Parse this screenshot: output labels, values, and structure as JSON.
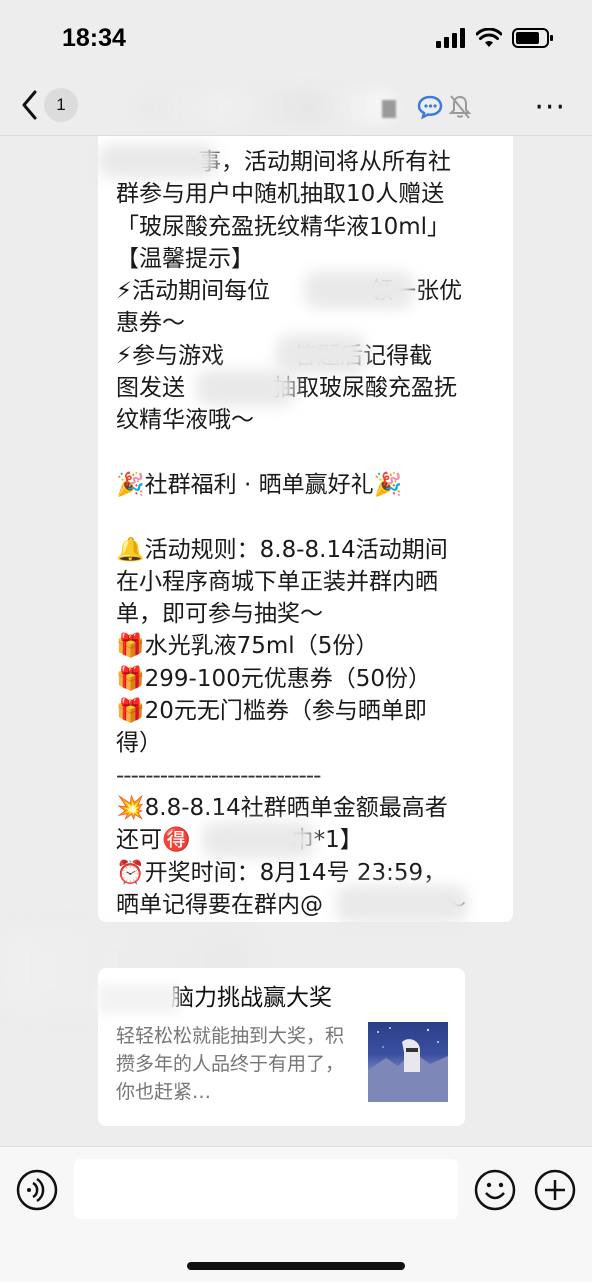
{
  "status_bar": {
    "time": "18:34"
  },
  "nav": {
    "unread_count": "1",
    "more": "···"
  },
  "message": {
    "lines": [
      "事，活动期间将从所有社",
      "群参与用户中随机抽取10人赠送",
      "「玻尿酸充盈抚纹精华液10ml」",
      "【温馨提示】",
      "⚡活动期间每位",
      "领一张优",
      "惠券～",
      "⚡参与游戏",
      "答题后记得截",
      "图发送",
      "抽取玻尿酸充盈抚",
      "纹精华液哦～",
      "🎉社群福利 · 晒单赢好礼🎉",
      "🔔活动规则：8.8-8.14活动期间",
      "在小程序商城下单正装并群内晒",
      "单，即可参与抽奖～",
      "🎁水光乳液75ml（5份）",
      "🎁299-100元优惠券（50份）",
      "🎁20元无门槛券（参与晒单即",
      "得）",
      "----------------------------",
      "💥8.8-8.14社群晒单金额最高者",
      "还可🉐",
      "巾*1】",
      "⏰开奖时间：8月14号 23:59，",
      "晒单记得要在群内@",
      "～"
    ]
  },
  "card": {
    "title": "脑力挑战赢大奖",
    "description": "轻轻松松就能抽到大奖，积攒多年的人品终于有用了，你也赶紧…"
  },
  "colors": {
    "background": "#ededed",
    "bubble": "#ffffff",
    "input_bar": "#f7f7f7"
  }
}
